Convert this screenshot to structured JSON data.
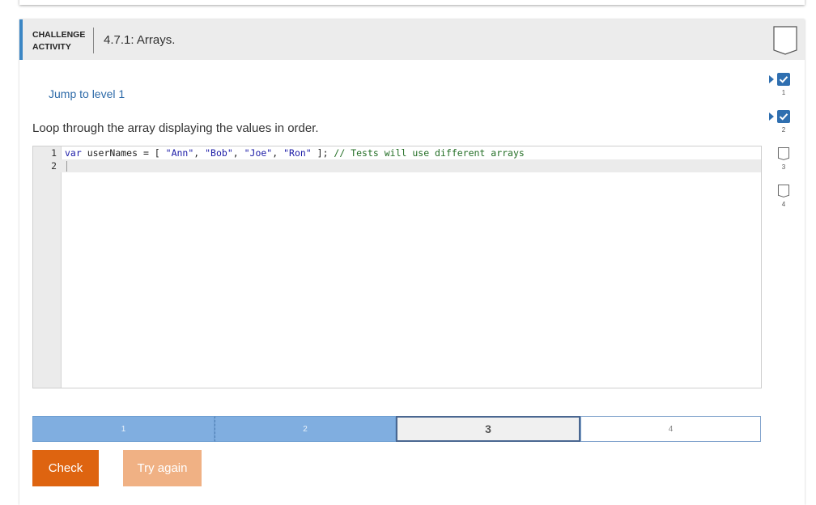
{
  "activity": {
    "type_label_line1": "CHALLENGE",
    "type_label_line2": "ACTIVITY",
    "title": "4.7.1: Arrays."
  },
  "jump_link": "Jump to level 1",
  "instructions": "Loop through the array displaying the values in order.",
  "editor": {
    "lines": [
      {
        "num": "1",
        "kw": "var",
        "ident": " userNames = [ ",
        "s1": "\"Ann\"",
        "c1": ", ",
        "s2": "\"Bob\"",
        "c2": ", ",
        "s3": "\"Joe\"",
        "c3": ", ",
        "s4": "\"Ron\"",
        "end": " ]; ",
        "comment": "// Tests will use different arrays"
      },
      {
        "num": "2"
      }
    ]
  },
  "progress": {
    "segments": [
      {
        "label": "1",
        "state": "done"
      },
      {
        "label": "2",
        "state": "done"
      },
      {
        "label": "3",
        "state": "current"
      },
      {
        "label": "4",
        "state": "future"
      }
    ]
  },
  "buttons": {
    "check": "Check",
    "try_again": "Try again"
  },
  "levels": [
    {
      "num": "1",
      "completed": true
    },
    {
      "num": "2",
      "completed": true
    },
    {
      "num": "3",
      "completed": false
    },
    {
      "num": "4",
      "completed": false
    }
  ],
  "colors": {
    "accent": "#3b86c4",
    "check_button": "#de6410",
    "try_again_button": "#f0b184",
    "progress_done": "#80aee0",
    "level_check": "#2f6fb0"
  }
}
